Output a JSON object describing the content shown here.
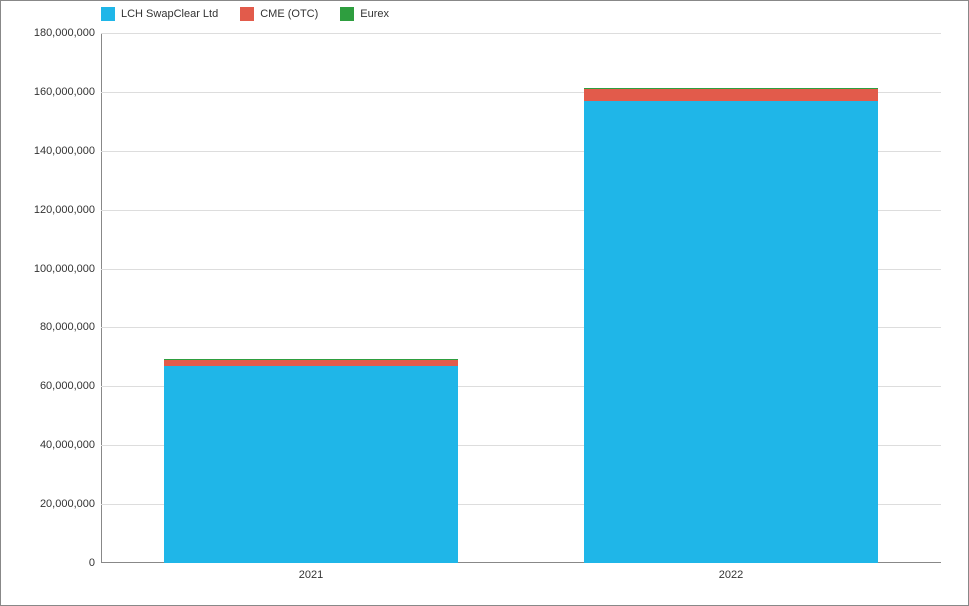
{
  "chart_data": {
    "type": "bar",
    "stacked": true,
    "categories": [
      "2021",
      "2022"
    ],
    "series": [
      {
        "name": "LCH SwapClear Ltd",
        "color": "#1fb6e8",
        "values": [
          67000000,
          157000000
        ]
      },
      {
        "name": "CME (OTC)",
        "color": "#e25b4b",
        "values": [
          2000000,
          4000000
        ]
      },
      {
        "name": "Eurex",
        "color": "#2e9e3f",
        "values": [
          200000,
          200000
        ]
      }
    ],
    "ylim": [
      0,
      180000000
    ],
    "y_ticks": [
      0,
      20000000,
      40000000,
      60000000,
      80000000,
      100000000,
      120000000,
      140000000,
      160000000,
      180000000
    ],
    "xlabel": "",
    "ylabel": "",
    "title": ""
  }
}
